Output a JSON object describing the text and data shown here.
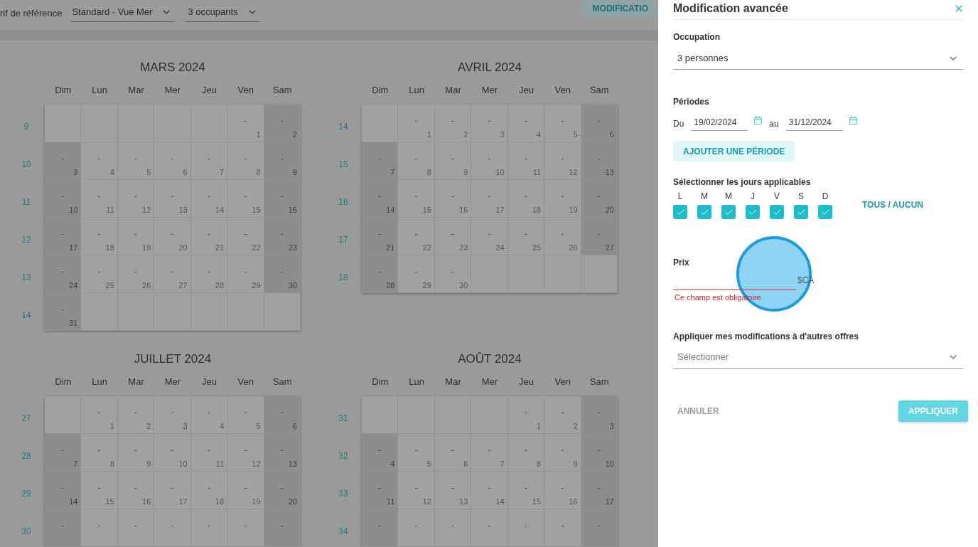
{
  "toolbar": {
    "reference_label": "rif de référence",
    "rate_select": {
      "value": "Standard - Vue Mer"
    },
    "occupancy_select": {
      "value": "3 occupants"
    },
    "action_button": "MODIFICATIO"
  },
  "months": [
    {
      "title": "MARS 2024",
      "weekdays": [
        "Dim",
        "Lun",
        "Mar",
        "Mer",
        "Jeu",
        "Ven",
        "Sam"
      ],
      "weeks": [
        {
          "number": "9",
          "days": [
            {
              "kind": "blank"
            },
            {
              "kind": "blank"
            },
            {
              "kind": "blank"
            },
            {
              "kind": "blank"
            },
            {
              "kind": "blank"
            },
            {
              "kind": "day",
              "price": "-",
              "date": "1"
            },
            {
              "kind": "day",
              "price": "-",
              "date": "2"
            }
          ]
        },
        {
          "number": "10",
          "days": [
            {
              "kind": "day",
              "price": "-",
              "date": "3"
            },
            {
              "kind": "day",
              "price": "-",
              "date": "4"
            },
            {
              "kind": "day",
              "price": "-",
              "date": "5"
            },
            {
              "kind": "day",
              "price": "-",
              "date": "6"
            },
            {
              "kind": "day",
              "price": "-",
              "date": "7"
            },
            {
              "kind": "day",
              "price": "-",
              "date": "8"
            },
            {
              "kind": "day",
              "price": "-",
              "date": "9"
            }
          ]
        },
        {
          "number": "11",
          "days": [
            {
              "kind": "day",
              "price": "-",
              "date": "10"
            },
            {
              "kind": "day",
              "price": "-",
              "date": "11"
            },
            {
              "kind": "day",
              "price": "-",
              "date": "12"
            },
            {
              "kind": "day",
              "price": "-",
              "date": "13"
            },
            {
              "kind": "day",
              "price": "-",
              "date": "14"
            },
            {
              "kind": "day",
              "price": "-",
              "date": "15"
            },
            {
              "kind": "day",
              "price": "-",
              "date": "16"
            }
          ]
        },
        {
          "number": "12",
          "days": [
            {
              "kind": "day",
              "price": "-",
              "date": "17"
            },
            {
              "kind": "day",
              "price": "-",
              "date": "18"
            },
            {
              "kind": "day",
              "price": "-",
              "date": "19"
            },
            {
              "kind": "day",
              "price": "-",
              "date": "20"
            },
            {
              "kind": "day",
              "price": "-",
              "date": "21"
            },
            {
              "kind": "day",
              "price": "-",
              "date": "22"
            },
            {
              "kind": "day",
              "price": "-",
              "date": "23"
            }
          ]
        },
        {
          "number": "13",
          "days": [
            {
              "kind": "day",
              "price": "-",
              "date": "24"
            },
            {
              "kind": "day",
              "price": "-",
              "date": "25"
            },
            {
              "kind": "day",
              "price": "-",
              "date": "26"
            },
            {
              "kind": "day",
              "price": "-",
              "date": "27"
            },
            {
              "kind": "day",
              "price": "-",
              "date": "28"
            },
            {
              "kind": "day",
              "price": "-",
              "date": "29"
            },
            {
              "kind": "day",
              "price": "-",
              "date": "30"
            }
          ]
        },
        {
          "number": "14",
          "days": [
            {
              "kind": "day",
              "price": "-",
              "date": "31"
            },
            {
              "kind": "blank"
            },
            {
              "kind": "blank"
            },
            {
              "kind": "blank"
            },
            {
              "kind": "blank"
            },
            {
              "kind": "blank"
            },
            {
              "kind": "blank"
            }
          ]
        }
      ]
    },
    {
      "title": "AVRIL 2024",
      "weekdays": [
        "Dim",
        "Lun",
        "Mar",
        "Mer",
        "Jeu",
        "Ven",
        "Sam"
      ],
      "weeks": [
        {
          "number": "14",
          "days": [
            {
              "kind": "blank"
            },
            {
              "kind": "day",
              "price": "-",
              "date": "1"
            },
            {
              "kind": "day",
              "price": "-",
              "date": "2"
            },
            {
              "kind": "day",
              "price": "-",
              "date": "3"
            },
            {
              "kind": "day",
              "price": "-",
              "date": "4"
            },
            {
              "kind": "day",
              "price": "-",
              "date": "5"
            },
            {
              "kind": "day",
              "price": "-",
              "date": "6"
            }
          ]
        },
        {
          "number": "15",
          "days": [
            {
              "kind": "day",
              "price": "-",
              "date": "7"
            },
            {
              "kind": "day",
              "price": "-",
              "date": "8"
            },
            {
              "kind": "day",
              "price": "-",
              "date": "9"
            },
            {
              "kind": "day",
              "price": "-",
              "date": "10"
            },
            {
              "kind": "day",
              "price": "-",
              "date": "11"
            },
            {
              "kind": "day",
              "price": "-",
              "date": "12"
            },
            {
              "kind": "day",
              "price": "-",
              "date": "13"
            }
          ]
        },
        {
          "number": "16",
          "days": [
            {
              "kind": "day",
              "price": "-",
              "date": "14"
            },
            {
              "kind": "day",
              "price": "-",
              "date": "15"
            },
            {
              "kind": "day",
              "price": "-",
              "date": "16"
            },
            {
              "kind": "day",
              "price": "-",
              "date": "17"
            },
            {
              "kind": "day",
              "price": "-",
              "date": "18"
            },
            {
              "kind": "day",
              "price": "-",
              "date": "19"
            },
            {
              "kind": "day",
              "price": "-",
              "date": "20"
            }
          ]
        },
        {
          "number": "17",
          "days": [
            {
              "kind": "day",
              "price": "-",
              "date": "21"
            },
            {
              "kind": "day",
              "price": "-",
              "date": "22"
            },
            {
              "kind": "day",
              "price": "-",
              "date": "23"
            },
            {
              "kind": "day",
              "price": "-",
              "date": "24"
            },
            {
              "kind": "day",
              "price": "-",
              "date": "25"
            },
            {
              "kind": "day",
              "price": "-",
              "date": "26"
            },
            {
              "kind": "day",
              "price": "-",
              "date": "27"
            }
          ]
        },
        {
          "number": "18",
          "days": [
            {
              "kind": "day",
              "price": "-",
              "date": "28"
            },
            {
              "kind": "day",
              "price": "-",
              "date": "29"
            },
            {
              "kind": "day",
              "price": "-",
              "date": "30"
            },
            {
              "kind": "blank"
            },
            {
              "kind": "blank"
            },
            {
              "kind": "blank"
            },
            {
              "kind": "blank"
            }
          ]
        }
      ]
    },
    {
      "title": "JUILLET 2024",
      "weekdays": [
        "Dim",
        "Lun",
        "Mar",
        "Mer",
        "Jeu",
        "Ven",
        "Sam"
      ],
      "weeks": [
        {
          "number": "27",
          "days": [
            {
              "kind": "blank"
            },
            {
              "kind": "day",
              "price": "-",
              "date": "1"
            },
            {
              "kind": "day",
              "price": "-",
              "date": "2"
            },
            {
              "kind": "day",
              "price": "-",
              "date": "3"
            },
            {
              "kind": "day",
              "price": "-",
              "date": "4"
            },
            {
              "kind": "day",
              "price": "-",
              "date": "5"
            },
            {
              "kind": "day",
              "price": "-",
              "date": "6"
            }
          ]
        },
        {
          "number": "28",
          "days": [
            {
              "kind": "day",
              "price": "-",
              "date": "7"
            },
            {
              "kind": "day",
              "price": "-",
              "date": "8"
            },
            {
              "kind": "day",
              "price": "-",
              "date": "9"
            },
            {
              "kind": "day",
              "price": "-",
              "date": "10"
            },
            {
              "kind": "day",
              "price": "-",
              "date": "11"
            },
            {
              "kind": "day",
              "price": "-",
              "date": "12"
            },
            {
              "kind": "day",
              "price": "-",
              "date": "13"
            }
          ]
        },
        {
          "number": "29",
          "days": [
            {
              "kind": "day",
              "price": "-",
              "date": "14"
            },
            {
              "kind": "day",
              "price": "-",
              "date": "15"
            },
            {
              "kind": "day",
              "price": "-",
              "date": "16"
            },
            {
              "kind": "day",
              "price": "-",
              "date": "17"
            },
            {
              "kind": "day",
              "price": "-",
              "date": "18"
            },
            {
              "kind": "day",
              "price": "-",
              "date": "19"
            },
            {
              "kind": "day",
              "price": "-",
              "date": "20"
            }
          ]
        },
        {
          "number": "30",
          "days": [
            {
              "kind": "day",
              "price": "-"
            },
            {
              "kind": "day",
              "price": "-"
            },
            {
              "kind": "day",
              "price": "-"
            },
            {
              "kind": "day",
              "price": "-"
            },
            {
              "kind": "day",
              "price": "-"
            },
            {
              "kind": "day",
              "price": "-"
            },
            {
              "kind": "day",
              "price": "-"
            }
          ]
        }
      ]
    },
    {
      "title": "AOÛT 2024",
      "weekdays": [
        "Dim",
        "Lun",
        "Mar",
        "Mer",
        "Jeu",
        "Ven",
        "Sam"
      ],
      "weeks": [
        {
          "number": "31",
          "days": [
            {
              "kind": "blank"
            },
            {
              "kind": "blank"
            },
            {
              "kind": "blank"
            },
            {
              "kind": "blank"
            },
            {
              "kind": "day",
              "price": "-",
              "date": "1"
            },
            {
              "kind": "day",
              "price": "-",
              "date": "2"
            },
            {
              "kind": "day",
              "price": "-",
              "date": "3"
            }
          ]
        },
        {
          "number": "32",
          "days": [
            {
              "kind": "day",
              "price": "-",
              "date": "4"
            },
            {
              "kind": "day",
              "price": "-",
              "date": "5"
            },
            {
              "kind": "day",
              "price": "-",
              "date": "6"
            },
            {
              "kind": "day",
              "price": "-",
              "date": "7"
            },
            {
              "kind": "day",
              "price": "-",
              "date": "8"
            },
            {
              "kind": "day",
              "price": "-",
              "date": "9"
            },
            {
              "kind": "day",
              "price": "-",
              "date": "10"
            }
          ]
        },
        {
          "number": "33",
          "days": [
            {
              "kind": "day",
              "price": "-",
              "date": "11"
            },
            {
              "kind": "day",
              "price": "-",
              "date": "12"
            },
            {
              "kind": "day",
              "price": "-",
              "date": "13"
            },
            {
              "kind": "day",
              "price": "-",
              "date": "14"
            },
            {
              "kind": "day",
              "price": "-",
              "date": "15"
            },
            {
              "kind": "day",
              "price": "-",
              "date": "16"
            },
            {
              "kind": "day",
              "price": "-",
              "date": "17"
            }
          ]
        },
        {
          "number": "34",
          "days": [
            {
              "kind": "day",
              "price": "-"
            },
            {
              "kind": "day",
              "price": "-"
            },
            {
              "kind": "day",
              "price": "-"
            },
            {
              "kind": "day",
              "price": "-"
            },
            {
              "kind": "day",
              "price": "-"
            },
            {
              "kind": "day",
              "price": "-"
            },
            {
              "kind": "day",
              "price": "-"
            }
          ]
        }
      ]
    }
  ],
  "panel": {
    "title": "Modification avancée",
    "occupation": {
      "label": "Occupation",
      "value": "3 personnes"
    },
    "periods": {
      "label": "Périodes",
      "from_label": "Du",
      "from": "19/02/2024",
      "to_label": "au",
      "to": "31/12/2024",
      "add_button": "AJOUTER UNE PÉRIODE"
    },
    "days": {
      "label": "Sélectionner les jours applicables",
      "toggle_all": "TOUS / AUCUN",
      "items": [
        {
          "letter": "L",
          "checked": true
        },
        {
          "letter": "M",
          "checked": true
        },
        {
          "letter": "M",
          "checked": true
        },
        {
          "letter": "J",
          "checked": true
        },
        {
          "letter": "V",
          "checked": true
        },
        {
          "letter": "S",
          "checked": true
        },
        {
          "letter": "D",
          "checked": true
        }
      ]
    },
    "price": {
      "label": "Prix",
      "suffix": "$CA",
      "error": "Ce champ est obligatoire"
    },
    "other_offers": {
      "label": "Appliquer mes modifications à d'autres offres",
      "placeholder": "Sélectionner"
    },
    "cancel_button": "ANNULER",
    "apply_button": {
      "label": "APPLIQUER",
      "disabled": true
    }
  }
}
